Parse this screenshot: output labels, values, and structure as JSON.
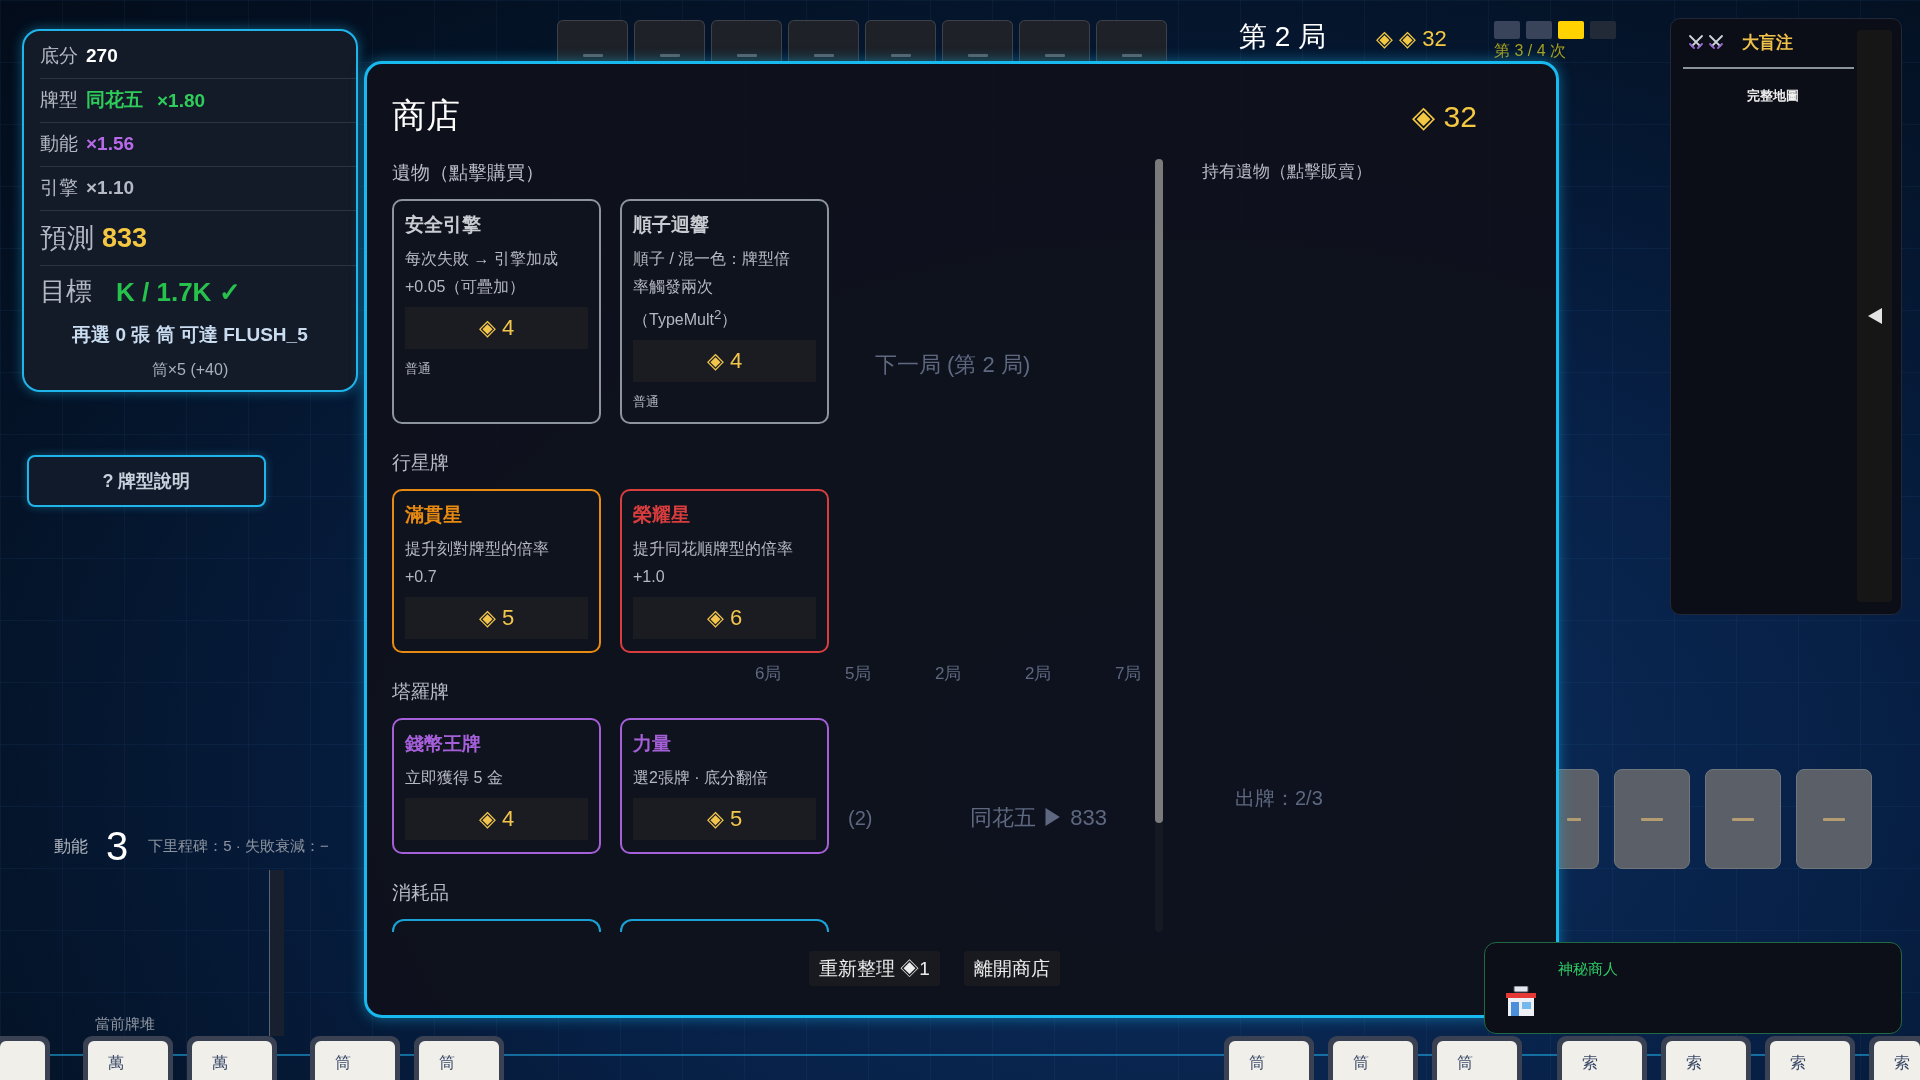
{
  "hud": {
    "stats": {
      "rows": [
        {
          "kind": "normal",
          "label": "底分",
          "value": "270",
          "color": "#ffffff"
        },
        {
          "kind": "normal",
          "label": "牌型",
          "value": "同花五",
          "extra": "×1.80",
          "color": "#2ecc5a"
        },
        {
          "kind": "normal",
          "label": "動能",
          "value": "×1.56",
          "color": "#b86ae8"
        },
        {
          "kind": "normal",
          "label": "引擎",
          "value": "×1.10",
          "color": "#b4b9c3"
        },
        {
          "kind": "large",
          "label": "預測",
          "value": "833",
          "color": "#f5c842"
        }
      ],
      "target": {
        "label": "目標",
        "value": "K / 1.7K ✓"
      },
      "hint": "再選 0 張 筒 可達 FLUSH_5",
      "hint_detail": "筒×5 (+40)"
    },
    "help_button": "? 牌型說明",
    "momentum": {
      "label": "動能",
      "value": "3",
      "note": "下里程碑：5 · 失敗衰減：−"
    },
    "deck_label": "當前牌堆",
    "top_slots": [
      {
        "kind": "empty"
      },
      {
        "kind": "empty"
      },
      {
        "kind": "empty"
      },
      {
        "kind": "empty"
      },
      {
        "kind": "empty"
      },
      {
        "kind": "empty"
      },
      {
        "kind": "empty"
      },
      {
        "kind": "empty"
      }
    ],
    "round_title": "第 2 局",
    "coins": "◈ ◈ 32",
    "attempts": [
      {
        "kind": "done"
      },
      {
        "kind": "done"
      },
      {
        "kind": "current"
      },
      {
        "kind": "pending"
      }
    ],
    "attempt_text": "第 3 / 4 次",
    "blind_panel": {
      "title": "大盲注",
      "link": "完整地圖"
    },
    "card_slots": [
      {
        "kind": "empty"
      },
      {
        "kind": "empty"
      },
      {
        "kind": "empty"
      },
      {
        "kind": "empty"
      }
    ],
    "merchant": {
      "title": "神秘商人"
    },
    "hand": {
      "left": [
        [
          {
            "kind": "blank"
          }
        ],
        [
          {
            "kind": "face",
            "label": "萬"
          },
          {
            "kind": "face",
            "label": "萬"
          }
        ],
        [
          {
            "kind": "face",
            "label": "筒"
          },
          {
            "kind": "face",
            "label": "筒"
          }
        ]
      ],
      "right": [
        [
          {
            "kind": "face",
            "label": "筒"
          },
          {
            "kind": "face",
            "label": "筒"
          },
          {
            "kind": "face",
            "label": "筒"
          }
        ],
        [
          {
            "kind": "face",
            "label": "索"
          },
          {
            "kind": "face",
            "label": "索"
          },
          {
            "kind": "face",
            "label": "索"
          },
          {
            "kind": "face",
            "label": "索"
          }
        ]
      ]
    }
  },
  "board_behind_shop": {
    "next_round": "下一局 (第 2 局)",
    "round_counts": [
      "6局",
      "5局",
      "2局",
      "2局",
      "7局"
    ],
    "selection": "(2)",
    "play_preview": "同花五 ▶ 833",
    "plays": "出牌：2/3"
  },
  "shop": {
    "title": "商店",
    "coins": "◈ 32",
    "sections": [
      {
        "title": "遺物（點擊購買）",
        "cards": [
          {
            "kind": "relic",
            "name": "安全引擎",
            "description": "每次失敗 → 引擎加成 +0.05（可疊加）",
            "price": "◈ 4",
            "rarity": "普通",
            "color": "#8e949e"
          },
          {
            "kind": "relic",
            "name": "順子迴響",
            "description": "順子 / 混一色：牌型倍率觸發兩次（TypeMult$^{2}$）",
            "price": "◈ 4",
            "rarity": "普通",
            "color": "#8e949e"
          }
        ]
      },
      {
        "title": "行星牌",
        "cards": [
          {
            "kind": "planet",
            "name": "滿貫星",
            "description": "提升刻對牌型的倍率 +0.7",
            "price": "◈ 5",
            "color": "#e88a12"
          },
          {
            "kind": "planet",
            "name": "榮耀星",
            "description": "提升同花順牌型的倍率 +1.0",
            "price": "◈ 6",
            "color": "#d93d3d"
          }
        ]
      },
      {
        "title": "塔羅牌",
        "cards": [
          {
            "kind": "tarot",
            "name": "錢幣王牌",
            "description": "立即獲得 5 金",
            "price": "◈ 4",
            "color": "#a55fd8"
          },
          {
            "kind": "tarot",
            "name": "力量",
            "description": "選2張牌 · 底分翻倍",
            "price": "◈ 5",
            "color": "#a55fd8"
          }
        ]
      },
      {
        "title": "消耗品",
        "cards": [
          {
            "kind": "consumable",
            "color": "#1aa2d6"
          },
          {
            "kind": "consumable",
            "color": "#1aa2d6"
          }
        ]
      }
    ],
    "owned_title": "持有遺物（點擊販賣）",
    "buttons": [
      "重新整理 ◈1",
      "離開商店"
    ]
  }
}
